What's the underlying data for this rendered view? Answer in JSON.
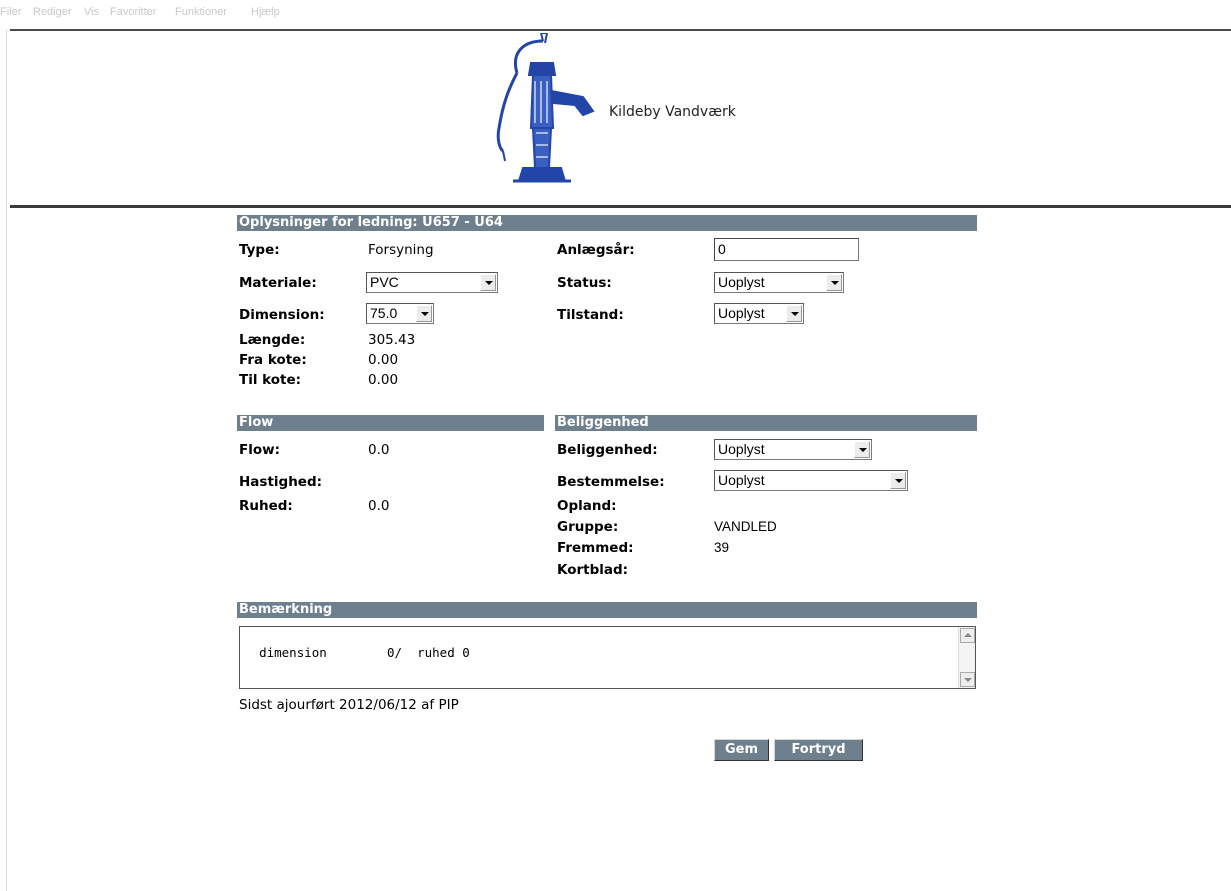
{
  "menu": [
    "Filer",
    "Rediger",
    "Vis",
    "Favoritter",
    "Funktioner",
    "Hjælp"
  ],
  "brand": "Kildeby Vandværk",
  "section_main": "Oplysninger for ledning: U657 - U64",
  "fields": {
    "type_label": "Type:",
    "type_value": "Forsyning",
    "materiale_label": "Materiale:",
    "materiale_value": "PVC",
    "dimension_label": "Dimension:",
    "dimension_value": "75.0",
    "laengde_label": "Længde:",
    "laengde_value": "305.43",
    "frakote_label": "Fra kote:",
    "frakote_value": "0.00",
    "tilkote_label": "Til kote:",
    "tilkote_value": "0.00",
    "anlaegsaar_label": "Anlægsår:",
    "anlaegsaar_value": "0",
    "status_label": "Status:",
    "status_value": "Uoplyst",
    "tilstand_label": "Tilstand:",
    "tilstand_value": "Uoplyst"
  },
  "section_flow": "Flow",
  "flow": {
    "flow_label": "Flow:",
    "flow_value": "0.0",
    "hastighed_label": "Hastighed:",
    "hastighed_value": "",
    "ruhed_label": "Ruhed:",
    "ruhed_value": "0.0"
  },
  "section_beliggenhed": "Beliggenhed",
  "beliggenhed": {
    "beliggenhed_label": "Beliggenhed:",
    "beliggenhed_value": "Uoplyst",
    "bestemmelse_label": "Bestemmelse:",
    "bestemmelse_value": "Uoplyst",
    "opland_label": "Opland:",
    "opland_value": "",
    "gruppe_label": "Gruppe:",
    "gruppe_value": "VANDLED",
    "fremmed_label": "Fremmed:",
    "fremmed_value": "39",
    "kortblad_label": "Kortblad:",
    "kortblad_value": ""
  },
  "section_bemaerkning": "Bemærkning",
  "bemaerkning_text": "dimension        0/  ruhed 0",
  "last_updated": "Sidst ajourført 2012/06/12 af PIP",
  "buttons": {
    "save": "Gem",
    "cancel": "Fortryd"
  },
  "colors": {
    "section_bar": "#6e7f8e",
    "logo_blue": "#2345a8"
  }
}
